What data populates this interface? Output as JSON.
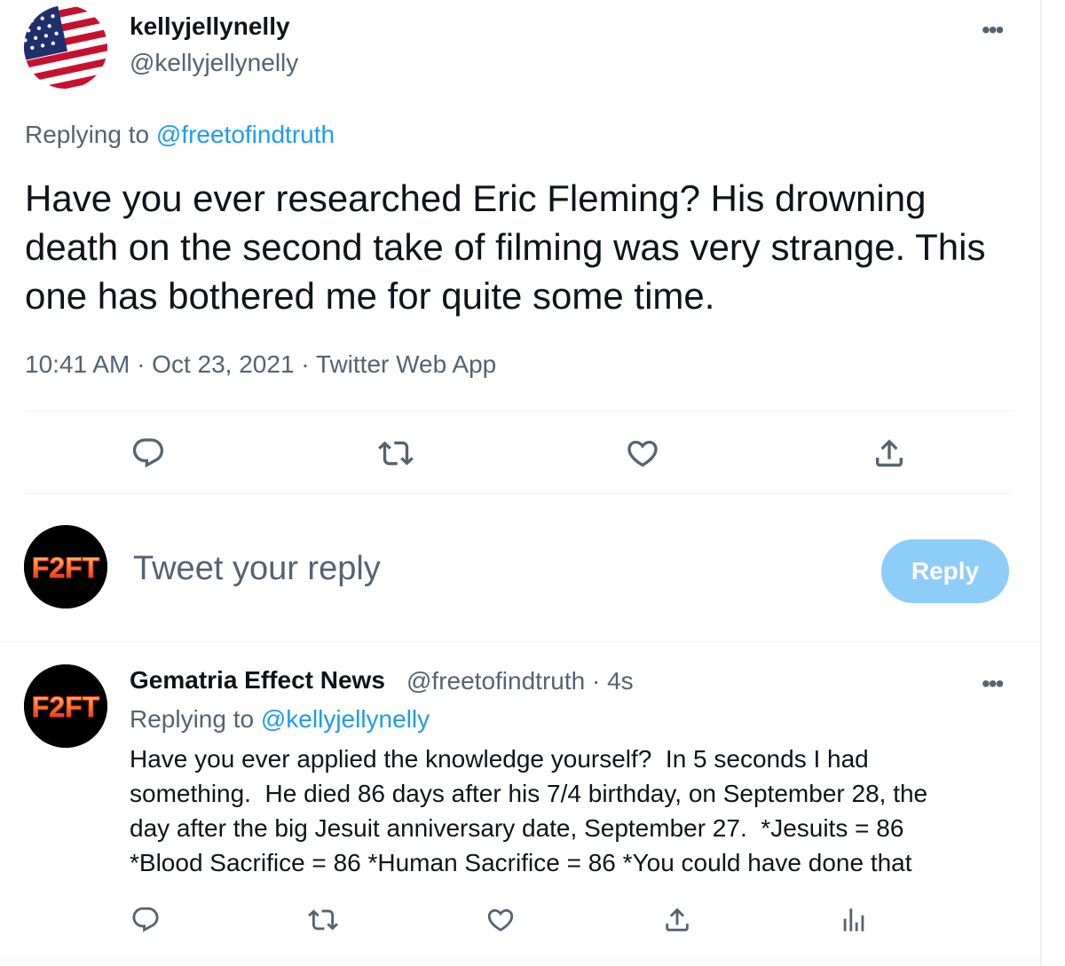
{
  "main_tweet": {
    "author_name": "kellyjellynelly",
    "author_handle": "@kellyjellynelly",
    "more_label": "•••",
    "replying_prefix": "Replying to ",
    "replying_to": "@freetofindtruth",
    "text": "Have you ever researched Eric Fleming? His drowning death on the second take of filming was very strange. This one has bothered me for quite some time.",
    "timestamp": "10:41 AM · Oct 23, 2021 · Twitter Web App",
    "avatar_icon": "us-flag-avatar",
    "actions": [
      "reply-icon",
      "retweet-icon",
      "like-icon",
      "share-icon"
    ]
  },
  "composer": {
    "placeholder": "Tweet your reply",
    "button_label": "Reply",
    "avatar_text": "F2FT",
    "button_color": "#8ecdf8"
  },
  "reply_tweet": {
    "author_name": "Gematria Effect News",
    "author_meta": "@freetofindtruth · 4s",
    "more_label": "•••",
    "replying_prefix": "Replying to ",
    "replying_to": "@kellyjellynelly",
    "text": "Have you ever applied the knowledge yourself?  In 5 seconds I had\nsomething.  He died 86 days after his 7/4 birthday, on September 28, the\nday after the big Jesuit anniversary date, September 27.  *Jesuits = 86\n*Blood Sacrifice = 86 *Human Sacrifice = 86 *You could have done that",
    "avatar_text": "F2FT",
    "actions": [
      "reply-icon",
      "retweet-icon",
      "like-icon",
      "share-icon",
      "analytics-icon"
    ]
  },
  "colors": {
    "text": "#0f1419",
    "secondary": "#536471",
    "accent": "#1d9bf0",
    "divider": "#eff3f4"
  }
}
